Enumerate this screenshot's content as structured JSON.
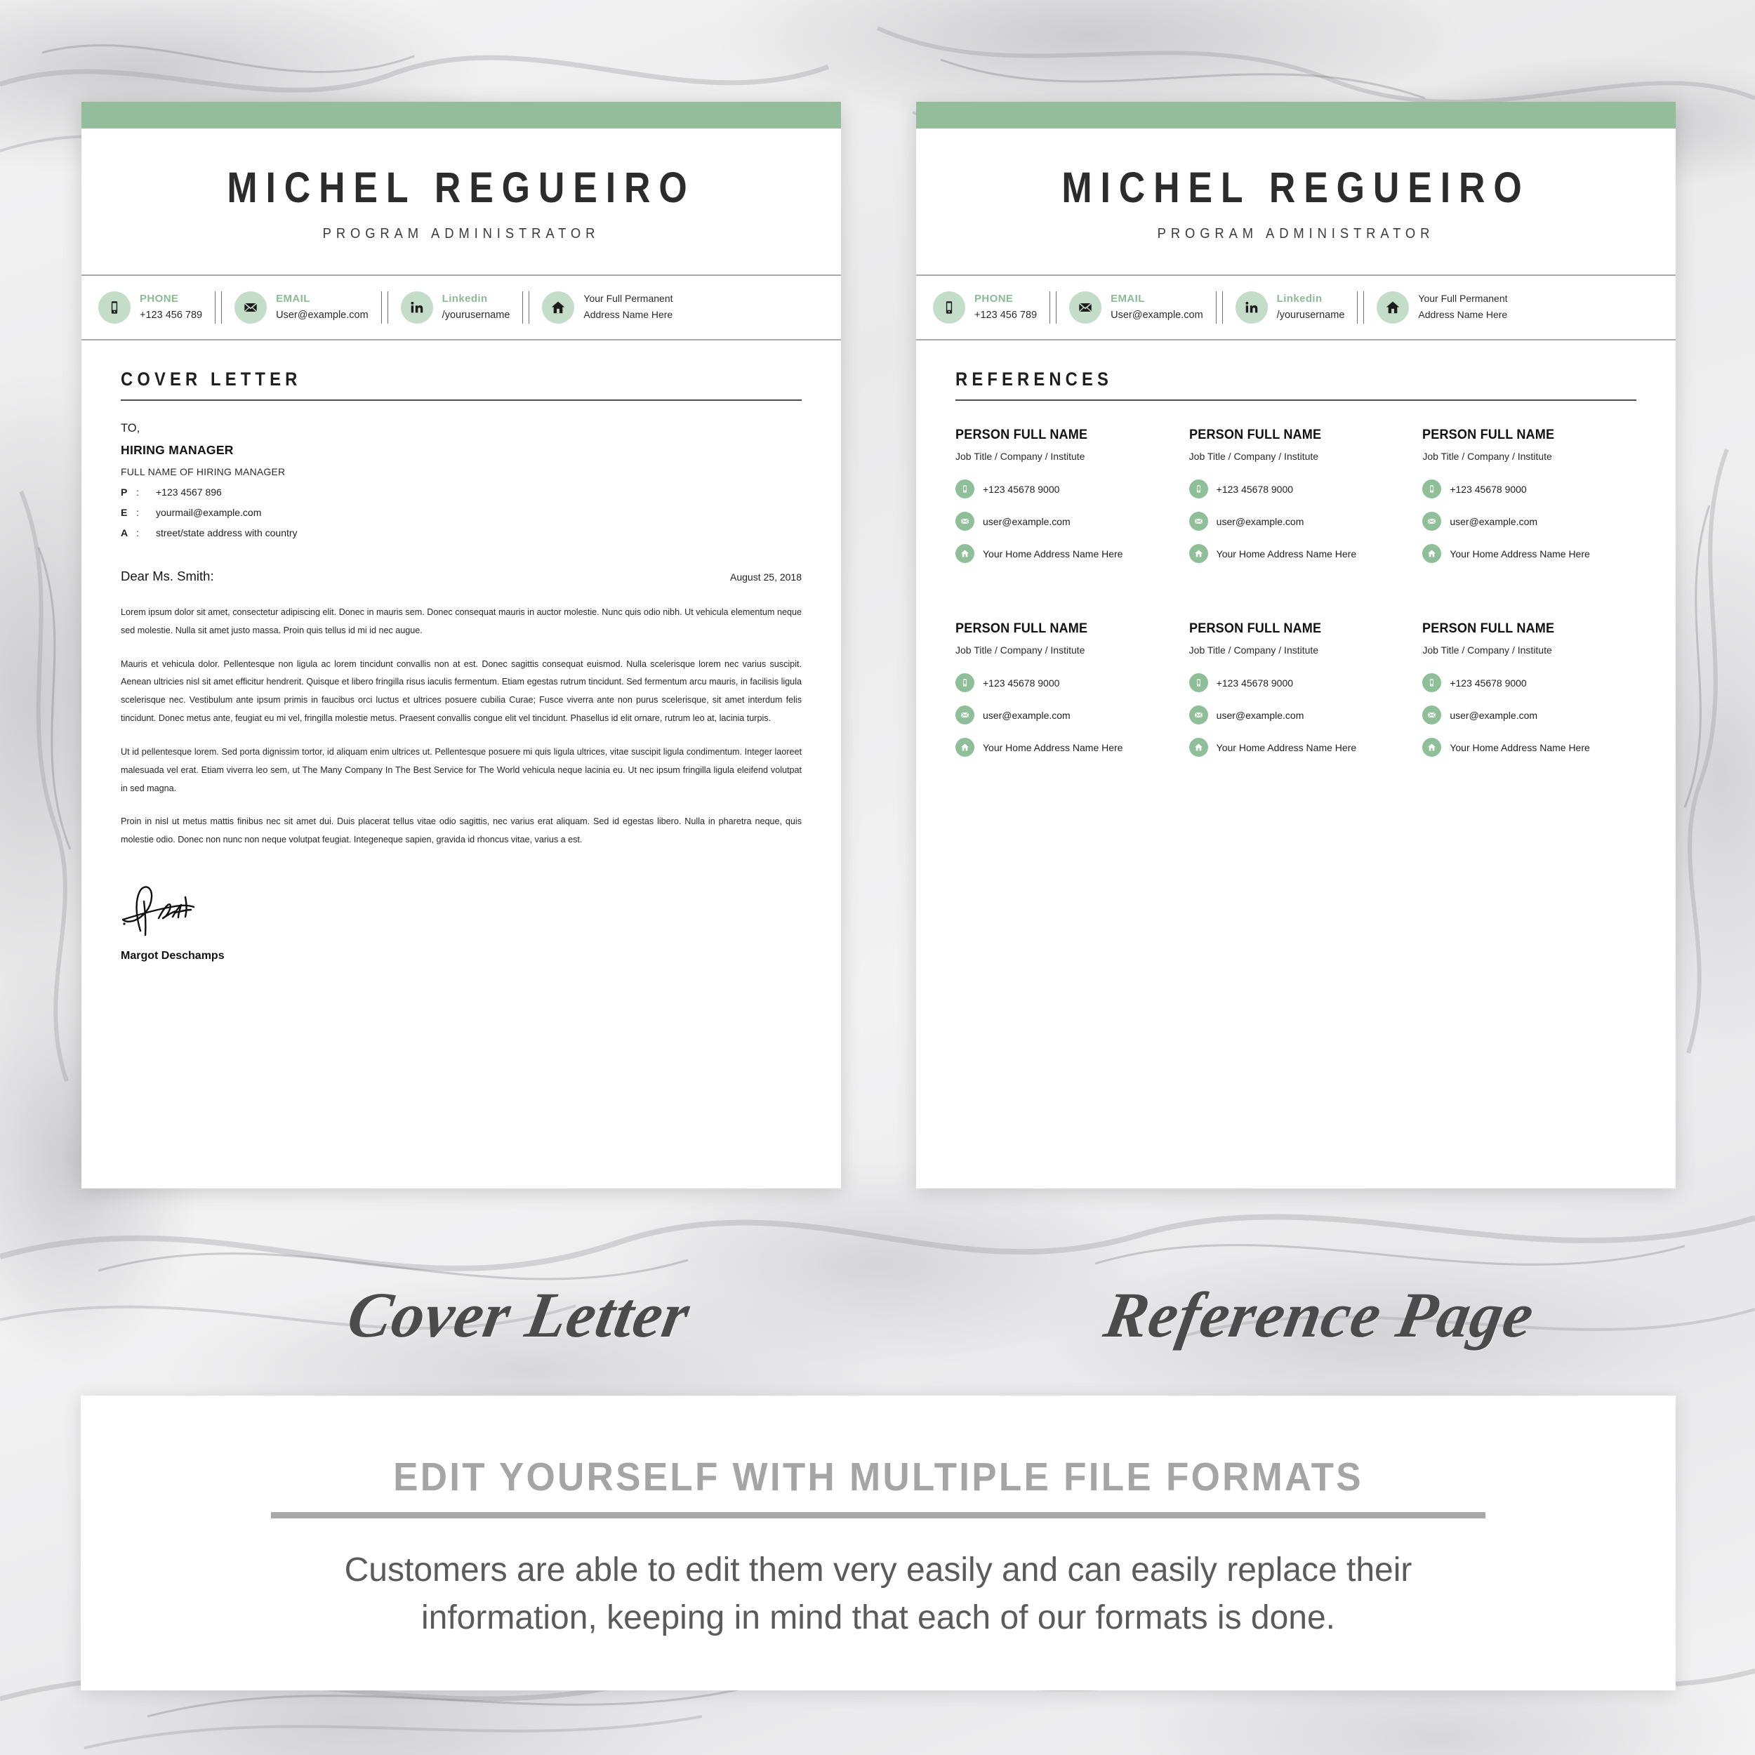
{
  "header": {
    "name": "MICHEL REGUEIRO",
    "role": "PROGRAM ADMINISTRATOR",
    "contacts": [
      {
        "icon": "phone-icon",
        "label": "PHONE",
        "value": "+123 456 789",
        "value2": ""
      },
      {
        "icon": "email-icon",
        "label": "EMAIL",
        "value": "User@example.com",
        "value2": ""
      },
      {
        "icon": "linkedin-icon",
        "label": "Linkedin",
        "value": "/yourusername",
        "value2": ""
      },
      {
        "icon": "home-icon",
        "label": "",
        "value": "Your Full Permanent",
        "value2": "Address Name Here"
      }
    ]
  },
  "cover_letter": {
    "section_title": "COVER LETTER",
    "to_label": "TO,",
    "to_name": "HIRING MANAGER",
    "to_sub": "FULL NAME OF HIRING MANAGER",
    "fields": [
      {
        "key": "P",
        "sep": ":",
        "value": "+123 4567 896"
      },
      {
        "key": "E",
        "sep": ":",
        "value": "yourmail@example.com"
      },
      {
        "key": "A",
        "sep": ":",
        "value": "street/state address with country"
      }
    ],
    "greeting": "Dear Ms. Smith:",
    "date": "August 25, 2018",
    "paragraphs": [
      "Lorem ipsum dolor sit amet, consectetur adipiscing elit. Donec in mauris sem. Donec consequat mauris in auctor molestie. Nunc quis odio nibh. Ut vehicula elementum neque sed molestie. Nulla sit amet justo massa. Proin quis tellus id mi  id nec augue.",
      "Mauris et vehicula dolor. Pellentesque non ligula ac lorem tincidunt convallis non at est. Donec sagittis consequat euismod. Nulla scelerisque lorem nec varius suscipit. Aenean ultricies nisl sit amet efficitur hendrerit. Quisque et libero fringilla risus iaculis fermentum. Etiam egestas rutrum tincidunt. Sed fermentum arcu mauris, in facilisis ligula scelerisque nec. Vestibulum ante ipsum primis in faucibus orci luctus et ultrices posuere cubilia Curae; Fusce viverra ante non purus scelerisque, sit amet interdum felis tincidunt. Donec metus ante, feugiat eu mi vel, fringilla molestie metus. Praesent convallis congue elit vel tincidunt. Phasellus id elit ornare, rutrum leo at, lacinia turpis.",
      "Ut id pellentesque lorem. Sed porta dignissim tortor, id aliquam enim ultrices ut. Pellentesque posuere mi quis ligula ultrices, vitae suscipit ligula condimentum. Integer laoreet malesuada vel erat. Etiam viverra leo sem, ut The Many Company In The Best Service for The World vehicula neque lacinia eu. Ut nec ipsum fringilla ligula eleifend volutpat in sed magna.",
      "Proin in nisl ut metus mattis finibus nec sit amet dui. Duis placerat tellus vitae odio sagittis, nec varius erat aliquam. Sed id egestas libero. Nulla in pharetra neque, quis molestie odio. Donec non nunc non neque volutpat feugiat. Integeneque sapien, gravida id rhoncus vitae, varius a est."
    ],
    "signature_name": "Margot Deschamps"
  },
  "references": {
    "section_title": "REFERENCES",
    "people": [
      {
        "name": "PERSON FULL NAME",
        "job": "Job Title / Company / Institute",
        "phone": "+123 45678 9000",
        "email": "user@example.com",
        "address": "Your Home Address Name Here"
      },
      {
        "name": "PERSON FULL NAME",
        "job": "Job Title / Company / Institute",
        "phone": "+123 45678 9000",
        "email": "user@example.com",
        "address": "Your Home Address Name Here"
      },
      {
        "name": "PERSON FULL NAME",
        "job": "Job Title / Company / Institute",
        "phone": "+123 45678 9000",
        "email": "user@example.com",
        "address": "Your Home Address Name Here"
      },
      {
        "name": "PERSON FULL NAME",
        "job": "Job Title / Company / Institute",
        "phone": "+123 45678 9000",
        "email": "user@example.com",
        "address": "Your Home Address Name Here"
      },
      {
        "name": "PERSON FULL NAME",
        "job": "Job Title / Company / Institute",
        "phone": "+123 45678 9000",
        "email": "user@example.com",
        "address": "Your Home Address Name Here"
      },
      {
        "name": "PERSON FULL NAME",
        "job": "Job Title / Company / Institute",
        "phone": "+123 45678 9000",
        "email": "user@example.com",
        "address": "Your Home Address Name Here"
      }
    ]
  },
  "captions": {
    "left": "Cover Letter",
    "right": "Reference Page"
  },
  "banner": {
    "heading": "EDIT YOURSELF WITH MULTIPLE FILE FORMATS",
    "line1": "Customers are able to edit them very easily and can easily replace their",
    "line2": "information, keeping in mind that each of our formats is done."
  },
  "colors": {
    "accent_green": "#93bd9b",
    "icon_circle": "#c4ddc9",
    "ref_icon_circle": "#8fbf98",
    "label_green": "#8cba95",
    "text_dark": "#1f1f1f",
    "banner_gray": "#a5a5a5"
  }
}
